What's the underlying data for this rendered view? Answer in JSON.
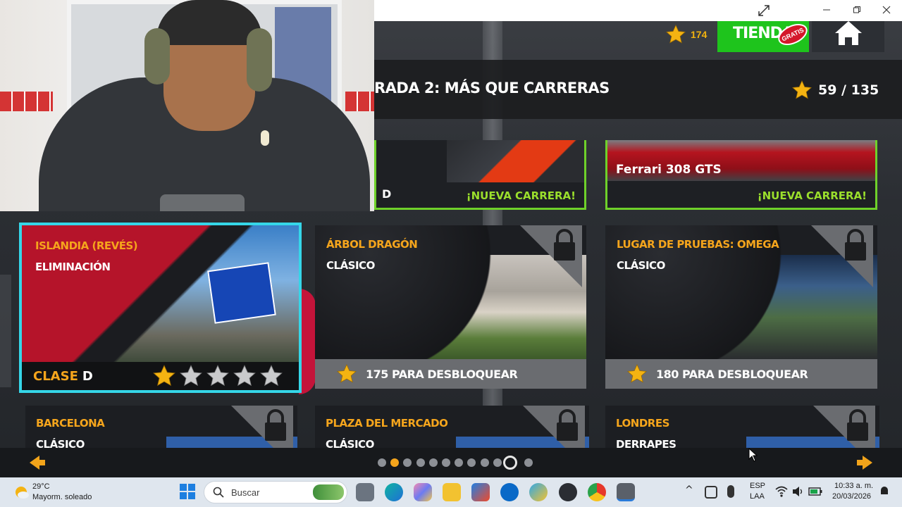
{
  "topbar": {
    "stars_count": "174",
    "tienda_label": "TIENDA",
    "gratis_badge": "GRATIS"
  },
  "title_bar": {
    "title": "RADA 2: MÁS QUE CARRERAS",
    "progress": "59 / 135"
  },
  "top_cards": [
    {
      "class_fragment": "D",
      "badge": "¡NUEVA CARRERA!"
    },
    {
      "car_name": "Ferrari 308 GTS",
      "badge": "¡NUEVA CARRERA!"
    }
  ],
  "cards": [
    {
      "location": "ISLANDIA (REVÉS)",
      "mode": "ELIMINACIÓN",
      "class_label": "CLASE",
      "class_value": "D",
      "rating": 1,
      "rating_max": 5
    },
    {
      "location": "ÁRBOL DRAGÓN",
      "mode": "CLÁSICO",
      "unlock": "175 PARA DESBLOQUEAR"
    },
    {
      "location": "LUGAR DE PRUEBAS: OMEGA",
      "mode": "CLÁSICO",
      "unlock": "180 PARA DESBLOQUEAR"
    },
    {
      "location": "BARCELONA",
      "mode": "CLÁSICO"
    },
    {
      "location": "PLAZA DEL MERCADO",
      "mode": "CLÁSICO"
    },
    {
      "location": "LONDRES",
      "mode": "DERRAPES"
    }
  ],
  "pager": {
    "total_pages": 12,
    "current_page": 11
  },
  "taskbar": {
    "weather_temp": "29°C",
    "weather_desc": "Mayorm. soleado",
    "search_placeholder": "Buscar",
    "lang_top": "ESP",
    "lang_bottom": "LAA",
    "time": "10:33 a. m.",
    "date": "20/03/2026"
  },
  "colors": {
    "accent_orange": "#f5a51c",
    "tienda_green": "#1ec41c",
    "selected_border": "#35d6e8",
    "new_race_green": "#9bdf2c"
  }
}
